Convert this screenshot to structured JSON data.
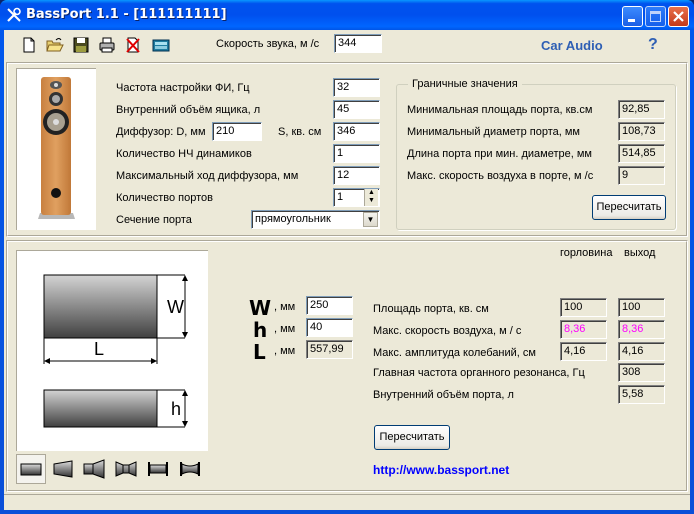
{
  "window": {
    "title": "BassPort 1.1 - [111111111]",
    "icon": "tools-icon",
    "controls": [
      "minimize",
      "maximize",
      "close"
    ]
  },
  "toolbar": {
    "icons": [
      "new-file-icon",
      "open-folder-icon",
      "save-icon",
      "print-icon",
      "delete-icon",
      "calculator-icon"
    ],
    "sound_speed_label": "Скорость звука, м /с",
    "sound_speed_value": "344",
    "car_audio_label": "Car Audio",
    "help_label": "?"
  },
  "params": {
    "tuning_freq_label": "Частота настройки ФИ, Гц",
    "tuning_freq_value": "32",
    "box_volume_label": "Внутренний объём ящика, л",
    "box_volume_value": "45",
    "diffuser_d_label": "Диффузор: D, мм",
    "diffuser_d_value": "210",
    "diffuser_s_label": "S, кв. см",
    "diffuser_s_value": "346",
    "woofer_count_label": "Количество НЧ динамиков",
    "woofer_count_value": "1",
    "max_excursion_label": "Максимальный ход диффузора, мм",
    "max_excursion_value": "12",
    "port_count_label": "Количество портов",
    "port_count_value": "1",
    "port_section_label": "Сечение порта",
    "port_section_value": "прямоугольник"
  },
  "limits": {
    "group_title": "Граничные значения",
    "rows": [
      {
        "label": "Минимальная площадь порта, кв.см",
        "value": "92,85"
      },
      {
        "label": "Минимальный диаметр порта, мм",
        "value": "108,73"
      },
      {
        "label": "Длина порта при мин. диаметре, мм",
        "value": "514,85"
      },
      {
        "label": "Макс. скорость воздуха в порте, м /с",
        "value": "9"
      }
    ],
    "recalc_label": "Пересчитать"
  },
  "port": {
    "diagram_labels": {
      "w": "W",
      "l": "L",
      "h": "h"
    },
    "w_symbol": "W",
    "w_unit": ", мм",
    "w_value": "250",
    "h_symbol": "h",
    "h_unit": ", мм",
    "h_value": "40",
    "l_symbol": "L",
    "l_unit": ", мм",
    "l_value": "557,99",
    "shapes": [
      "straight-port-icon",
      "flared-port-icon",
      "stepped-port-icon",
      "double-flared-port-icon",
      "flanged-port-icon",
      "hourglass-port-icon"
    ]
  },
  "results": {
    "col_throat": "горловина",
    "col_exit": "выход",
    "area_label": "Площадь порта, кв. см",
    "area_throat": "100",
    "area_exit": "100",
    "air_speed_label": "Макс. скорость воздуха, м / с",
    "air_speed_throat": "8,36",
    "air_speed_exit": "8,36",
    "amplitude_label": "Макс. амплитуда колебаний, см",
    "amplitude_throat": "4,16",
    "amplitude_exit": "4,16",
    "organ_res_label": "Главная частота органного резонанса, Гц",
    "organ_res_value": "308",
    "port_volume_label": "Внутренний объём порта, л",
    "port_volume_value": "5,58",
    "recalc_label": "Пересчитать",
    "warn_color": "#FF00FF"
  },
  "footer": {
    "link": "http://www.bassport.net",
    "link_color": "#0000FF"
  }
}
